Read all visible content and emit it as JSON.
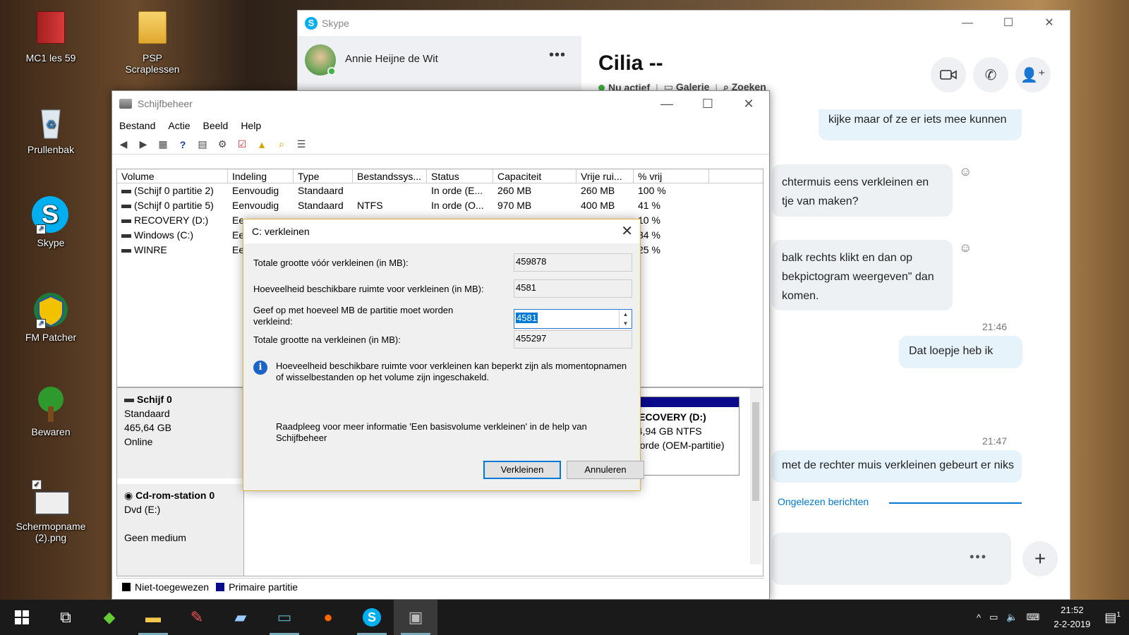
{
  "desktop": {
    "icons": [
      {
        "label": "MC1 les 59"
      },
      {
        "label": "PSP Scraplessen"
      },
      {
        "label": "Prullenbak"
      },
      {
        "label": "Skype"
      },
      {
        "label": "FM Patcher"
      },
      {
        "label": "Bewaren"
      },
      {
        "label": "Schermopname (2).png"
      }
    ]
  },
  "skype": {
    "window_title": "Skype",
    "user_name": "Annie Heijne de Wit",
    "more": "•••",
    "chat_title": "Cilia --",
    "status": "Nu actief",
    "gallery": "Galerie",
    "search": "Zoeken",
    "messages": [
      {
        "text": "kijke maar of ze er iets mee kunnen"
      },
      {
        "text": "chtermuis eens verkleinen en tje van maken?"
      },
      {
        "text": "balk rechts klikt en dan op bekpictogram weergeven\" dan komen."
      },
      {
        "time": "21:46"
      },
      {
        "text": "Dat loepje heb ik"
      },
      {
        "time": "21:47"
      },
      {
        "text": "met de rechter muis verkleinen gebeurt er niks"
      }
    ],
    "unread": "Ongelezen berichten",
    "compose_more": "•••"
  },
  "diskmgmt": {
    "window_title": "Schijfbeheer",
    "menu": [
      "Bestand",
      "Actie",
      "Beeld",
      "Help"
    ],
    "columns": [
      "Volume",
      "Indeling",
      "Type",
      "Bestandssys...",
      "Status",
      "Capaciteit",
      "Vrije rui...",
      "% vrij"
    ],
    "rows": [
      [
        "(Schijf 0 partitie 2)",
        "Eenvoudig",
        "Standaard",
        "",
        "In orde (E...",
        "260 MB",
        "260 MB",
        "100 %"
      ],
      [
        "(Schijf 0 partitie 5)",
        "Eenvoudig",
        "Standaard",
        "NTFS",
        "In orde (O...",
        "970 MB",
        "400 MB",
        "41 %"
      ],
      [
        "RECOVERY (D:)",
        "Ee",
        "",
        "",
        "",
        "",
        "",
        "10 %"
      ],
      [
        "Windows (C:)",
        "Ee",
        "",
        "",
        "",
        "",
        "",
        "34 %"
      ],
      [
        "WINRE",
        "Ee",
        "",
        "",
        "",
        "",
        "",
        "25 %"
      ]
    ],
    "disk0": {
      "name": "Schijf 0",
      "type": "Standaard",
      "size": "465,64 GB",
      "state": "Online"
    },
    "cdrom": {
      "name": "Cd-rom-station 0",
      "type": "Dvd (E:)",
      "state": "Geen medium"
    },
    "partition": {
      "name": "RECOVERY  (D:)",
      "size": "14,94 GB NTFS",
      "status": "n orde (OEM-partitie)"
    },
    "legend": {
      "unallocated": "Niet-toegewezen",
      "primary": "Primaire partitie"
    },
    "colors": {
      "unallocated": "#000000",
      "primary": "#0a0a8a"
    }
  },
  "dialog": {
    "title": "C: verkleinen",
    "total_label": "Totale grootte vóór verkleinen (in MB):",
    "total_value": "459878",
    "available_label": "Hoeveelheid beschikbare ruimte voor verkleinen (in MB):",
    "available_value": "4581",
    "shrink_label": "Geef op met hoeveel MB de partitie moet worden verkleind:",
    "shrink_value": "4581",
    "after_label": "Totale grootte na verkleinen (in MB):",
    "after_value": "455297",
    "info_text": "Hoeveelheid beschikbare ruimte voor verkleinen kan beperkt zijn als momentopnamen of wisselbestanden op het volume zijn ingeschakeld.",
    "help_text": "Raadpleeg voor meer informatie 'Een basisvolume verkleinen' in de help van Schijfbeheer",
    "ok_button": "Verkleinen",
    "cancel_button": "Annuleren"
  },
  "taskbar": {
    "time": "21:52",
    "date": "2-2-2019",
    "notifications": "1"
  }
}
